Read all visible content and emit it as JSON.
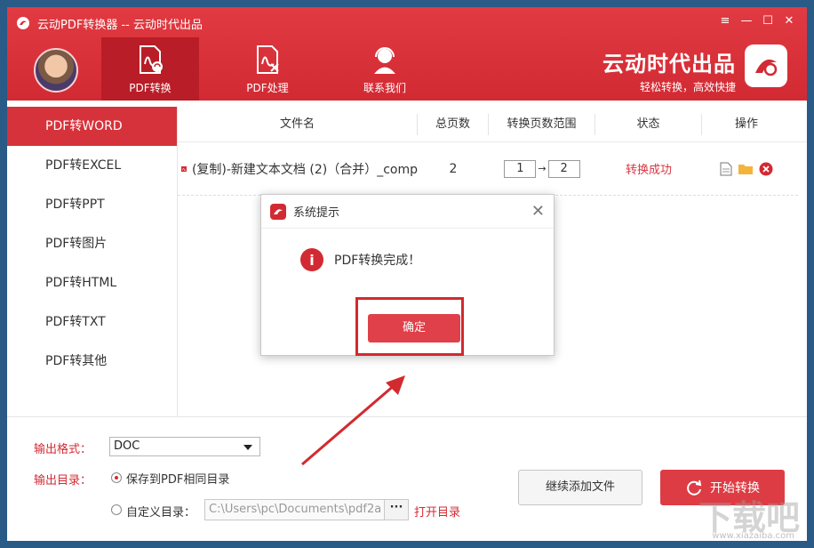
{
  "window": {
    "title": "云动PDF转换器 -- 云动时代出品",
    "controls": {
      "menu": "≡",
      "minimize": "—",
      "maximize": "☐",
      "close": "✕"
    }
  },
  "tabs": [
    {
      "label": "PDF转换",
      "active": true,
      "icon": "pdf-convert-icon"
    },
    {
      "label": "PDF处理",
      "active": false,
      "icon": "pdf-process-icon"
    },
    {
      "label": "联系我们",
      "active": false,
      "icon": "support-agent-icon"
    }
  ],
  "brand": {
    "name": "云动时代出品",
    "slogan": "轻松转换，高效快捷"
  },
  "sidebar": {
    "items": [
      {
        "label": "PDF转WORD",
        "active": true
      },
      {
        "label": "PDF转EXCEL",
        "active": false
      },
      {
        "label": "PDF转PPT",
        "active": false
      },
      {
        "label": "PDF转图片",
        "active": false
      },
      {
        "label": "PDF转HTML",
        "active": false
      },
      {
        "label": "PDF转TXT",
        "active": false
      },
      {
        "label": "PDF转其他",
        "active": false
      }
    ]
  },
  "table": {
    "headers": [
      "文件名",
      "总页数",
      "转换页数范围",
      "状态",
      "操作"
    ],
    "rows": [
      {
        "filename": "(复制)-新建文本文档 (2)（合并）_comp",
        "pages": "2",
        "from": "1",
        "to": "2",
        "status": "转换成功"
      }
    ]
  },
  "bottom": {
    "format_label": "输出格式：",
    "format_value": "DOC",
    "dir_label": "输出目录：",
    "option_same": "保存到PDF相同目录",
    "option_custom": "自定义目录：",
    "custom_path": "C:\\Users\\pc\\Documents\\pdf2a",
    "dots": "···",
    "open_dir": "打开目录",
    "add_files": "继续添加文件",
    "start": "开始转换"
  },
  "dialog": {
    "title": "系统提示",
    "message": "PDF转换完成！",
    "ok": "确定",
    "close": "✕"
  },
  "watermark": {
    "main": "下载吧",
    "sub": "www.xiazaiba.com"
  },
  "colors": {
    "accent": "#d22a33",
    "sidebar_active": "#d6323b",
    "status_ok": "#d7363f"
  }
}
